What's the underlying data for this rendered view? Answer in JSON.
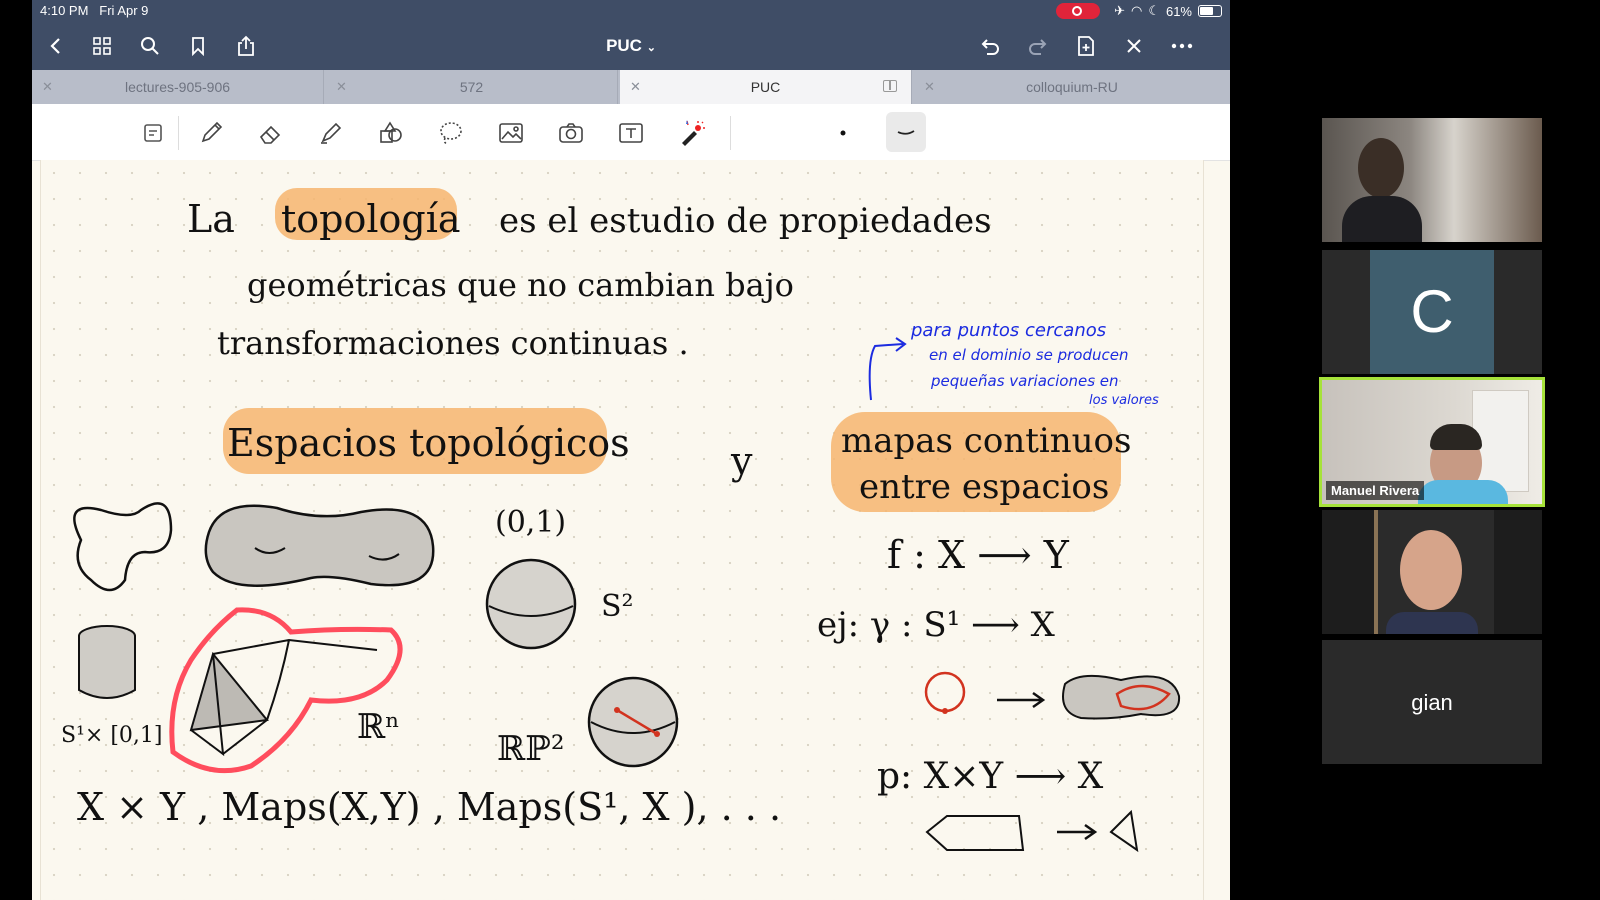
{
  "status_bar": {
    "time": "4:10 PM",
    "date": "Fri Apr 9",
    "battery": "61%"
  },
  "nav": {
    "title": "PUC"
  },
  "tabs": [
    {
      "label": "lectures-905-906",
      "active": false
    },
    {
      "label": "572",
      "active": false
    },
    {
      "label": "PUC",
      "active": true
    },
    {
      "label": "colloquium-RU",
      "active": false
    }
  ],
  "toolbar": {
    "icons": [
      "page-icon",
      "pen-icon",
      "eraser-icon",
      "highlighter-icon",
      "shapes-icon",
      "lasso-icon",
      "image-icon",
      "camera-icon",
      "text-icon",
      "laser-pointer-icon"
    ]
  },
  "note": {
    "line1": {
      "w1": "La",
      "w2": "topología",
      "w3": "es el estudio de propiedades"
    },
    "line2": "geométricas   que   no   cambian   bajo",
    "line3": "transformaciones   continuas .",
    "side_note": [
      "para puntos cercanos",
      "en el dominio se producen",
      "pequeñas variaciones en",
      "los valores"
    ],
    "heading_spaces": "Espacios topológicos",
    "y": "y",
    "heading_maps": [
      "mapas continuos",
      "entre espacios"
    ],
    "interval": "(0,1)",
    "s2": "S²",
    "cylinder": "S¹× [0,1]",
    "rn": "ℝⁿ",
    "rp2": "ℝℙ²",
    "f_map": "f : X ⟶ Y",
    "ej_map": "ej: γ : S¹ ⟶ X",
    "p_map": "p: X×Y ⟶ X",
    "bottom_line": "X × Y ,  Maps(X,Y) ,  Maps(S¹, X ), . . ."
  },
  "participants": [
    {
      "name": "",
      "type": "video"
    },
    {
      "name": "",
      "type": "initial",
      "initial": "C"
    },
    {
      "name": "Manuel Rivera",
      "type": "video",
      "active": true
    },
    {
      "name": "",
      "type": "video"
    },
    {
      "name": "gian",
      "type": "name-only"
    }
  ]
}
